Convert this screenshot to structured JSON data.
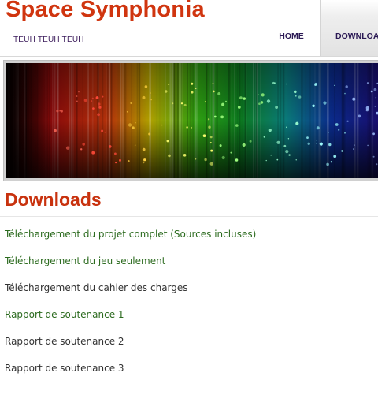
{
  "site": {
    "title": "Space Symphonia",
    "tagline": "TEUH TEUH TEUH"
  },
  "nav": {
    "items": [
      {
        "label": "HOME",
        "active": false
      },
      {
        "label": "DOWNLOADS",
        "active": true
      }
    ]
  },
  "banner": {
    "description": "rainbow-spectrum-light-streaks"
  },
  "main": {
    "heading": "Downloads",
    "downloads": [
      {
        "label": "Téléchargement du projet complet (Sources incluses)",
        "color": "#2c6b1f"
      },
      {
        "label": "Téléchargement du jeu seulement",
        "color": "#2c6b1f"
      },
      {
        "label": "Téléchargement du cahier des charges",
        "color": "#333333"
      },
      {
        "label": "Rapport de soutenance 1",
        "color": "#2c6b1f"
      },
      {
        "label": "Rapport de soutenance 2",
        "color": "#333333"
      },
      {
        "label": "Rapport de soutenance 3",
        "color": "#333333"
      }
    ]
  },
  "colors": {
    "title": "#d0350f",
    "heading": "#c8320e",
    "nav_text": "#2c1a55",
    "link_visited": "#2c6b1f",
    "link": "#333333"
  }
}
